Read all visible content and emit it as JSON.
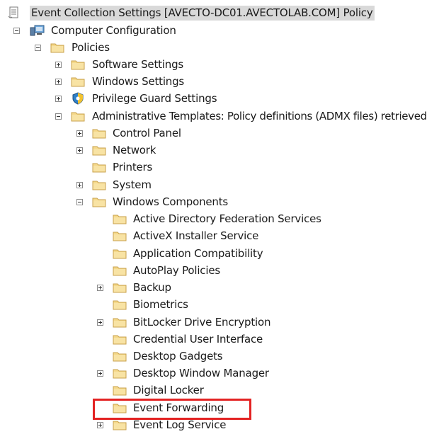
{
  "colors": {
    "highlight_border": "#e32222",
    "folder_fill": "#f5d88a",
    "folder_edge": "#c8a24c",
    "selected_bg": "#d9d9d9"
  },
  "tree": {
    "root": {
      "label": "Event Collection Settings [AVECTO-DC01.AVECTOLAB.COM] Policy",
      "icon": "policy-document-icon"
    },
    "computer_configuration": {
      "label": "Computer Configuration",
      "icon": "computer-icon",
      "state": "expanded"
    },
    "policies": {
      "label": "Policies",
      "icon": "folder-icon",
      "state": "expanded"
    },
    "software_settings": {
      "label": "Software Settings",
      "icon": "folder-icon",
      "state": "collapsed"
    },
    "windows_settings": {
      "label": "Windows Settings",
      "icon": "folder-icon",
      "state": "collapsed"
    },
    "privilege_guard_settings": {
      "label": "Privilege Guard Settings",
      "icon": "privilege-guard-shield-icon",
      "state": "collapsed"
    },
    "administrative_templates": {
      "label": "Administrative Templates: Policy definitions (ADMX files) retrieved",
      "icon": "folder-icon",
      "state": "expanded"
    },
    "control_panel": {
      "label": "Control Panel",
      "icon": "folder-icon",
      "state": "collapsed"
    },
    "network": {
      "label": "Network",
      "icon": "folder-icon",
      "state": "collapsed"
    },
    "printers": {
      "label": "Printers",
      "icon": "folder-icon",
      "state": "leaf"
    },
    "system": {
      "label": "System",
      "icon": "folder-icon",
      "state": "collapsed"
    },
    "windows_components": {
      "label": "Windows Components",
      "icon": "folder-icon",
      "state": "expanded"
    },
    "adfs": {
      "label": "Active Directory Federation Services",
      "icon": "folder-icon",
      "state": "leaf"
    },
    "activex": {
      "label": "ActiveX Installer Service",
      "icon": "folder-icon",
      "state": "leaf"
    },
    "app_compat": {
      "label": "Application Compatibility",
      "icon": "folder-icon",
      "state": "leaf"
    },
    "autoplay": {
      "label": "AutoPlay Policies",
      "icon": "folder-icon",
      "state": "leaf"
    },
    "backup": {
      "label": "Backup",
      "icon": "folder-icon",
      "state": "collapsed"
    },
    "biometrics": {
      "label": "Biometrics",
      "icon": "folder-icon",
      "state": "leaf"
    },
    "bitlocker": {
      "label": "BitLocker Drive Encryption",
      "icon": "folder-icon",
      "state": "collapsed"
    },
    "credential_ui": {
      "label": "Credential User Interface",
      "icon": "folder-icon",
      "state": "leaf"
    },
    "desktop_gadgets": {
      "label": "Desktop Gadgets",
      "icon": "folder-icon",
      "state": "leaf"
    },
    "dwm": {
      "label": "Desktop Window Manager",
      "icon": "folder-icon",
      "state": "collapsed"
    },
    "digital_locker": {
      "label": "Digital Locker",
      "icon": "folder-icon",
      "state": "leaf"
    },
    "event_forwarding": {
      "label": "Event Forwarding",
      "icon": "folder-icon",
      "state": "leaf",
      "highlighted": true
    },
    "event_log_service": {
      "label": "Event Log Service",
      "icon": "folder-icon",
      "state": "collapsed"
    }
  }
}
